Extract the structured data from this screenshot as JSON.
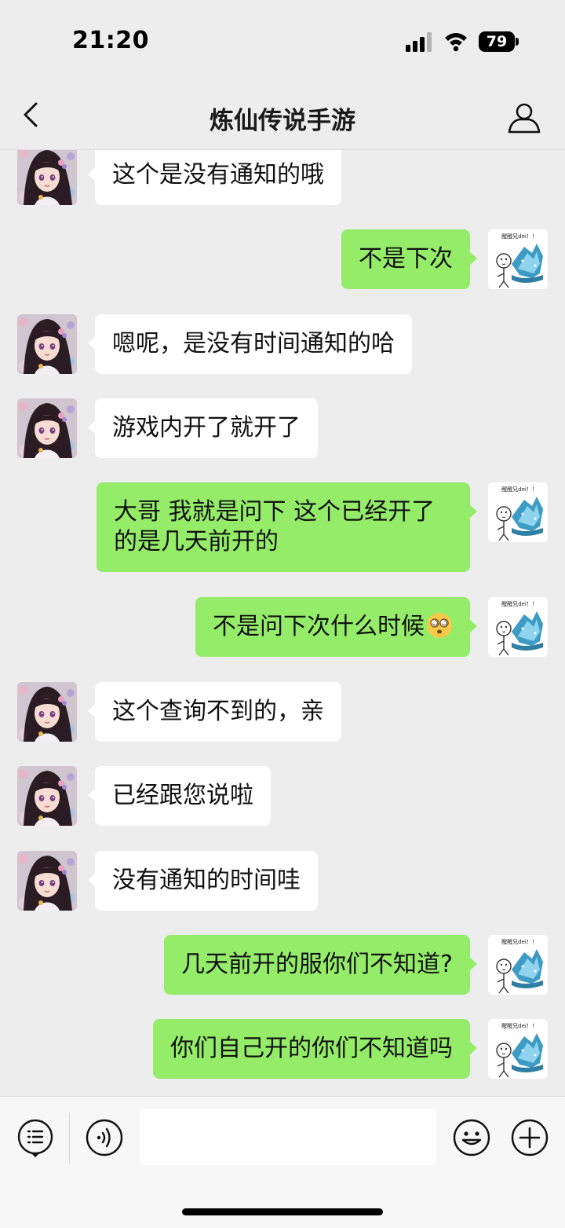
{
  "status": {
    "time": "21:20",
    "battery": "79"
  },
  "nav": {
    "title": "炼仙传说手游"
  },
  "avatar_me_caption": "醒醒兄dei！！",
  "messages": [
    {
      "side": "in",
      "text": "这个是没有通知的哦"
    },
    {
      "side": "out",
      "text": "不是下次"
    },
    {
      "side": "in",
      "text": "嗯呢，是没有时间通知的哈"
    },
    {
      "side": "in",
      "text": "游戏内开了就开了"
    },
    {
      "side": "out",
      "text": "大哥 我就是问下 这个已经开了的是几天前开的"
    },
    {
      "side": "out",
      "text": "不是问下次什么时候",
      "emoji": "dizzy-face"
    },
    {
      "side": "in",
      "text": "这个查询不到的，亲"
    },
    {
      "side": "in",
      "text": "已经跟您说啦"
    },
    {
      "side": "in",
      "text": "没有通知的时间哇"
    },
    {
      "side": "out",
      "text": "几天前开的服你们不知道?"
    },
    {
      "side": "out",
      "text": "你们自己开的你们不知道吗"
    }
  ],
  "input": {
    "placeholder": ""
  },
  "colors": {
    "background": "#ededed",
    "bubble_out": "#95ec69",
    "bubble_in": "#ffffff"
  }
}
